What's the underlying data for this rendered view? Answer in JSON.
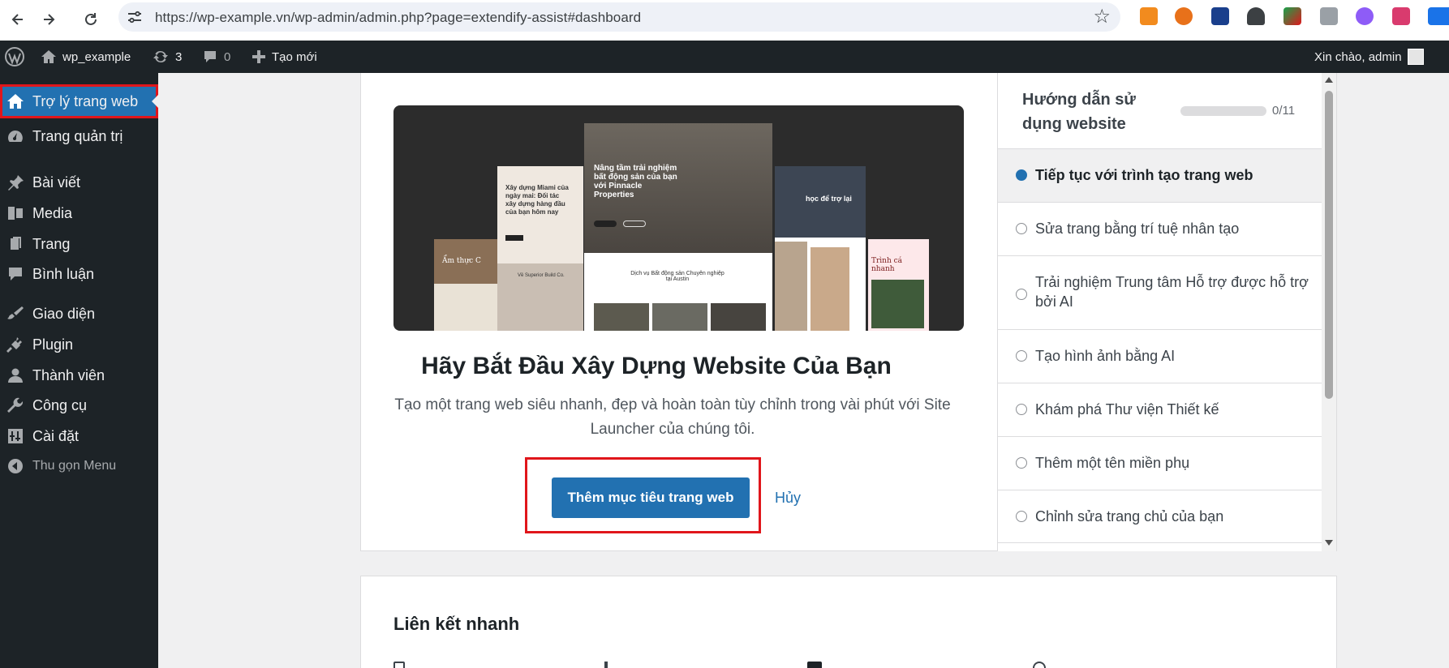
{
  "browser": {
    "url": "https://wp-example.vn/wp-admin/admin.php?page=extendify-assist#dashboard",
    "nav": {
      "back_icon": "arrow-left-icon",
      "forward_icon": "arrow-right-icon",
      "reload_icon": "reload-icon"
    },
    "extensions": [
      {
        "name": "extension-1-icon",
        "color": "#f28b1e"
      },
      {
        "name": "extension-2-icon",
        "color": "#e8711a"
      },
      {
        "name": "extension-3-icon",
        "color": "#1a3f8c"
      },
      {
        "name": "extension-4-icon",
        "color": "#3c4043"
      },
      {
        "name": "extension-5-icon",
        "color": "#17a34a"
      },
      {
        "name": "extension-6-icon",
        "color": "#9aa0a6"
      },
      {
        "name": "extension-7-icon",
        "color": "#8e5cf7"
      },
      {
        "name": "extension-8-icon",
        "color": "#d93b6e"
      }
    ]
  },
  "adminbar": {
    "site_name": "wp_example",
    "updates_count": "3",
    "comments_count": "0",
    "new_label": "Tạo mới",
    "greeting": "Xin chào, admin"
  },
  "sidebar": {
    "items": [
      {
        "label": "Trợ lý trang web",
        "icon": "home-icon"
      },
      {
        "label": "Trang quản trị",
        "icon": "dashboard-icon"
      },
      {
        "label": "Bài viết",
        "icon": "pin-icon"
      },
      {
        "label": "Media",
        "icon": "media-icon"
      },
      {
        "label": "Trang",
        "icon": "page-icon"
      },
      {
        "label": "Bình luận",
        "icon": "comment-icon"
      },
      {
        "label": "Giao diện",
        "icon": "brush-icon"
      },
      {
        "label": "Plugin",
        "icon": "plugin-icon"
      },
      {
        "label": "Thành viên",
        "icon": "user-icon"
      },
      {
        "label": "Công cụ",
        "icon": "wrench-icon"
      },
      {
        "label": "Cài đặt",
        "icon": "settings-icon"
      }
    ],
    "collapse_label": "Thu gọn Menu"
  },
  "launch": {
    "title": "Hãy Bắt Đầu Xây Dựng Website Của Bạn",
    "description": "Tạo một trang web siêu nhanh, đẹp và hoàn toàn tùy chỉnh trong vài phút với Site Launcher của chúng tôi.",
    "cta_label": "Thêm mục tiêu trang web",
    "cancel_label": "Hủy",
    "preview_texts": {
      "main_heading": "Nâng tầm trải nghiệm bất động sản của bạn với Pinnacle Properties",
      "main_sub": "Dịch vụ Bất động sản Chuyên nghiệp tại Austin",
      "left_heading": "Xây dựng Miami của ngày mai: Đối tác xây dựng hàng đầu của bạn hôm nay",
      "left_sub": "Về Superior Build Co.",
      "far_left_heading": "Ẩm thực C",
      "right_heading": "học để trợ lại",
      "far_right_heading": "Trình cá nhanh"
    }
  },
  "guide": {
    "title": "Hướng dẫn sử dụng website",
    "progress": "0/11",
    "progress_fraction": 0,
    "steps": [
      {
        "label": "Tiếp tục với trình tạo trang web",
        "active": true
      },
      {
        "label": "Sửa trang bằng trí tuệ nhân tạo",
        "active": false
      },
      {
        "label": "Trải nghiệm Trung tâm Hỗ trợ được hỗ trợ bởi AI",
        "active": false
      },
      {
        "label": "Tạo hình ảnh bằng AI",
        "active": false
      },
      {
        "label": "Khám phá Thư viện Thiết kế",
        "active": false
      },
      {
        "label": "Thêm một tên miền phụ",
        "active": false
      },
      {
        "label": "Chỉnh sửa trang chủ của bạn",
        "active": false
      }
    ]
  },
  "quick_links": {
    "title": "Liên kết nhanh"
  }
}
